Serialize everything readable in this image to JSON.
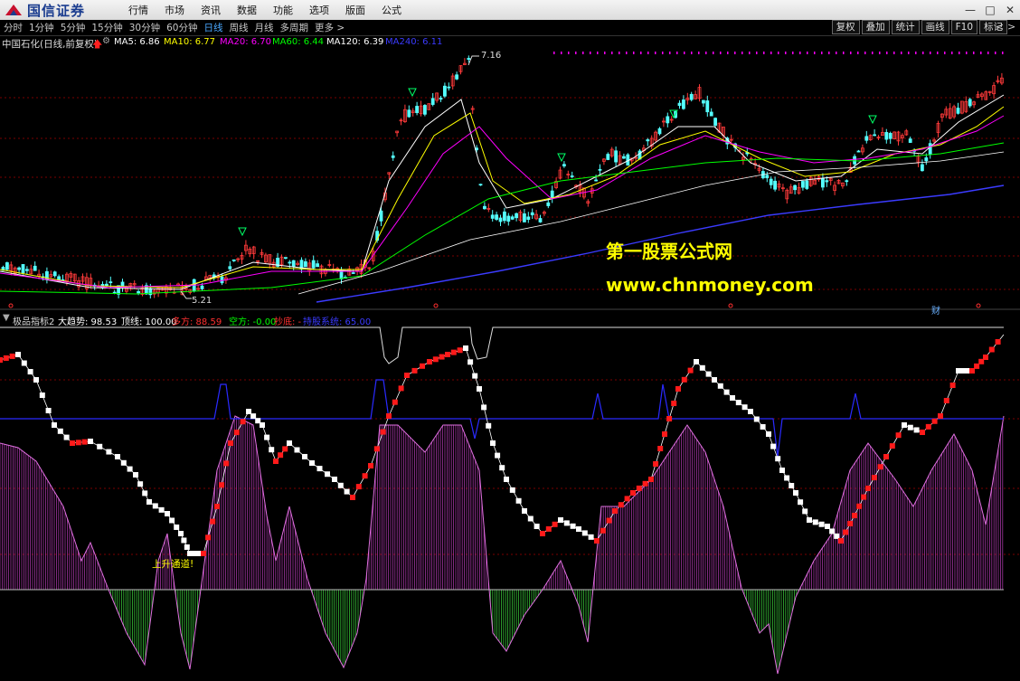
{
  "app": {
    "logo_text": "国信证券",
    "menu": [
      "行情",
      "市场",
      "资讯",
      "数据",
      "功能",
      "选项",
      "版面",
      "公式"
    ],
    "window_controls": [
      "minimize-icon",
      "maximize-icon",
      "close-icon"
    ]
  },
  "toolbar": {
    "periods": [
      "分时",
      "1分钟",
      "5分钟",
      "15分钟",
      "30分钟",
      "60分钟",
      "日线",
      "周线",
      "月线",
      "多周期",
      "更多 >"
    ],
    "active_period": "日线",
    "tools": [
      "复权",
      "叠加",
      "统计",
      "画线",
      "F10",
      "标记"
    ],
    "prev_arrow": "<",
    "next_arrow": ">"
  },
  "main_panel": {
    "title": "中国石化(日线,前复权)",
    "ma": [
      {
        "label": "MA5: 6.86",
        "color": "#ffffff"
      },
      {
        "label": "MA10: 6.77",
        "color": "#ffff00"
      },
      {
        "label": "MA20: 6.70",
        "color": "#ff00ff"
      },
      {
        "label": "MA60: 6.44",
        "color": "#00ff00"
      },
      {
        "label": "MA120: 6.39",
        "color": "#ffffff"
      },
      {
        "label": "MA240: 6.11",
        "color": "#3b3bff"
      }
    ],
    "high_label": "7.16",
    "low_label": "5.21",
    "watermark_cn": "第一股票公式网",
    "watermark_url": "www.chnmoney.com",
    "finance_mark": "财"
  },
  "indicator_panel": {
    "title": "极品指标2",
    "fields": [
      {
        "label": "大趋势: 98.53",
        "color": "#ffffff"
      },
      {
        "label": "顶线: 100.00",
        "color": "#ffffff"
      },
      {
        "label": "多方: 88.59",
        "color": "#ff3030"
      },
      {
        "label": "空方: -0.00",
        "color": "#00ff00"
      },
      {
        "label": "抄底: -",
        "color": "#ff3030"
      },
      {
        "label": "持股系统: 65.00",
        "color": "#3b3bff"
      }
    ],
    "annotation": "上升通道!"
  },
  "colors": {
    "up_candle": "#ff3a3a",
    "down_candle": "#54ffff",
    "bg": "#000000",
    "grid": "#7a0000",
    "watermark": "#ffff00"
  }
}
